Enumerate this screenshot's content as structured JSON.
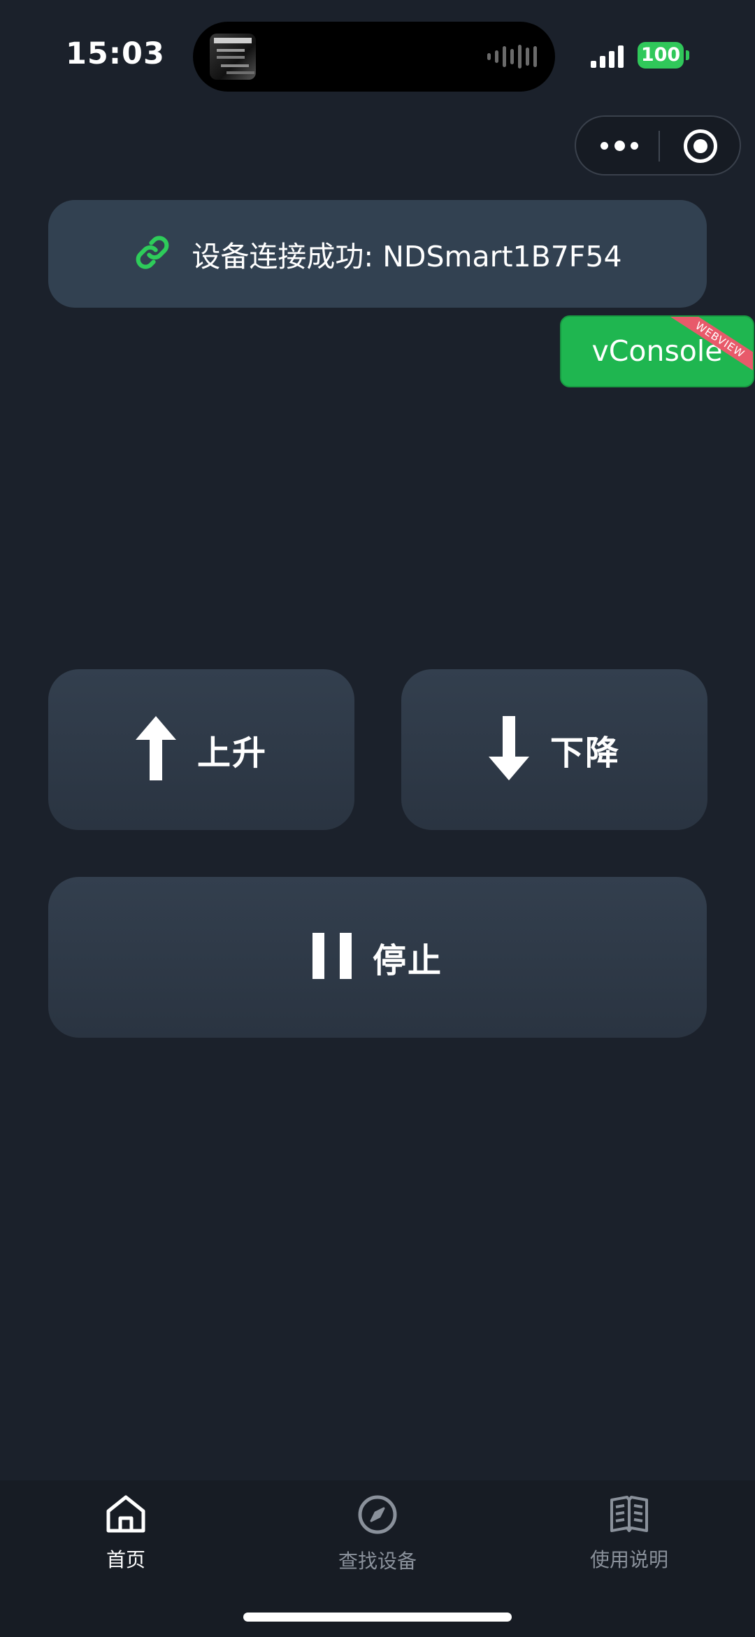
{
  "status_bar": {
    "time": "15:03",
    "battery": "100",
    "battery_color": "#30c85a"
  },
  "capsule": {
    "more_icon": "more-dots-icon",
    "close_icon": "target-circle-icon"
  },
  "connection": {
    "icon": "link-icon",
    "icon_color": "#2ecc5a",
    "text": "设备连接成功: NDSmart1B7F54"
  },
  "vconsole": {
    "label": "vConsole",
    "ribbon": "WEBVIEW",
    "color": "#1fb650"
  },
  "controls": {
    "up": {
      "label": "上升",
      "icon": "arrow-up-icon"
    },
    "down": {
      "label": "下降",
      "icon": "arrow-down-icon"
    },
    "stop": {
      "label": "停止",
      "icon": "pause-icon"
    }
  },
  "tabbar": {
    "items": [
      {
        "label": "首页",
        "icon": "home-icon",
        "active": true
      },
      {
        "label": "查找设备",
        "icon": "compass-icon",
        "active": false
      },
      {
        "label": "使用说明",
        "icon": "book-icon",
        "active": false
      }
    ]
  },
  "colors": {
    "background": "#1b212b",
    "card": "#324151",
    "tabbar": "#171c24",
    "inactive_text": "#8a919b"
  }
}
